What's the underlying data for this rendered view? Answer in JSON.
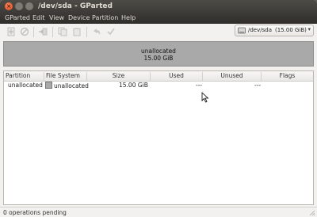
{
  "window": {
    "title": "/dev/sda - GParted"
  },
  "menu": [
    "GParted",
    "Edit",
    "View",
    "Device",
    "Partition",
    "Help"
  ],
  "toolbar": {
    "icons": [
      "new-icon",
      "delete-icon",
      "resize-icon",
      "copy-icon",
      "paste-icon",
      "undo-icon",
      "apply-icon"
    ]
  },
  "device": {
    "name": "/dev/sda",
    "size": "(15.00 GiB)"
  },
  "visual": {
    "label": "unallocated",
    "size": "15.00 GiB"
  },
  "table": {
    "headers": [
      "Partition",
      "File System",
      "Size",
      "Used",
      "Unused",
      "Flags"
    ],
    "rows": [
      {
        "partition": "unallocated",
        "filesystem": "unallocated",
        "size": "15.00 GiB",
        "used": "---",
        "unused": "---",
        "flags": ""
      }
    ]
  },
  "status": {
    "text": "0 operations pending"
  },
  "colors": {
    "unallocated": "#a9a9a9",
    "titlebar": "#3c3b37",
    "close_button": "#e2531e"
  }
}
